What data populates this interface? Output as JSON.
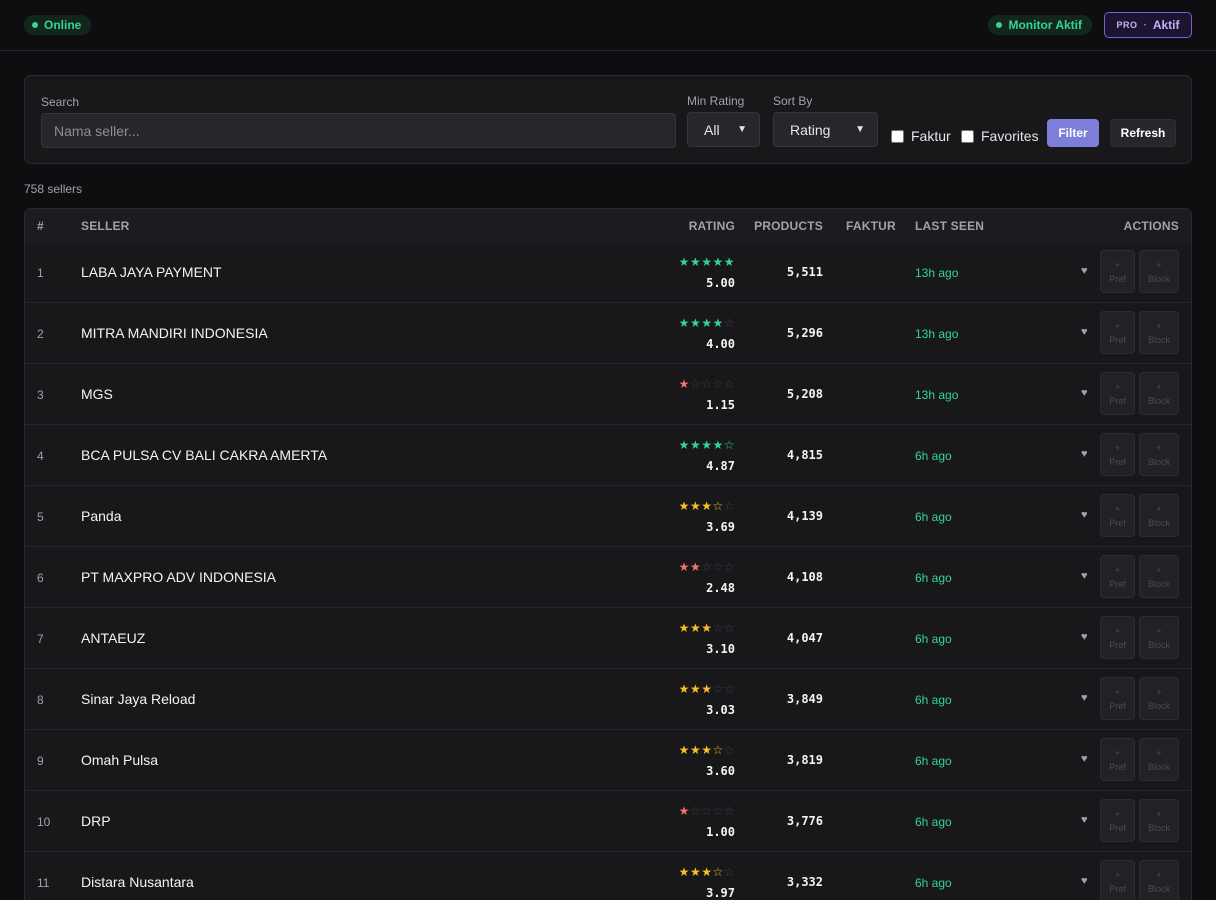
{
  "header": {
    "status_online": "Online",
    "monitor_status": "Monitor Aktif",
    "plan_label": "PRO",
    "plan_sep": "·",
    "plan_status": "Aktif"
  },
  "filters": {
    "search_label": "Search",
    "search_placeholder": "Nama seller...",
    "search_value": "",
    "min_rating_label": "Min Rating",
    "min_rating_value": "All",
    "sort_by_label": "Sort By",
    "sort_by_value": "Rating",
    "faktur_label": "Faktur",
    "faktur_checked": false,
    "favorites_label": "Favorites",
    "favorites_checked": false,
    "filter_button": "Filter",
    "refresh_button": "Refresh"
  },
  "summary": {
    "count_text": "758 sellers"
  },
  "table": {
    "columns": [
      "#",
      "SELLER",
      "RATING",
      "PRODUCTS",
      "FAKTUR",
      "LAST SEEN",
      "ACTIONS"
    ],
    "action_labels": {
      "pref": "Pref",
      "block": "Block",
      "plus": "+"
    },
    "colors": {
      "high": "#34d399",
      "mid": "#fbbf24",
      "low": "#f87171",
      "empty": "#3f3f46"
    },
    "rows": [
      {
        "num": "1",
        "seller": "LABA JAYA PAYMENT",
        "rating": 5.0,
        "rating_text": "5.00",
        "products": "5,511",
        "faktur": "",
        "last_seen": "13h ago"
      },
      {
        "num": "2",
        "seller": "MITRA MANDIRI INDONESIA",
        "rating": 4.0,
        "rating_text": "4.00",
        "products": "5,296",
        "faktur": "",
        "last_seen": "13h ago"
      },
      {
        "num": "3",
        "seller": "MGS",
        "rating": 1.15,
        "rating_text": "1.15",
        "products": "5,208",
        "faktur": "",
        "last_seen": "13h ago"
      },
      {
        "num": "4",
        "seller": "BCA PULSA CV BALI CAKRA AMERTA",
        "rating": 4.87,
        "rating_text": "4.87",
        "products": "4,815",
        "faktur": "",
        "last_seen": "6h ago"
      },
      {
        "num": "5",
        "seller": "Panda",
        "rating": 3.69,
        "rating_text": "3.69",
        "products": "4,139",
        "faktur": "",
        "last_seen": "6h ago"
      },
      {
        "num": "6",
        "seller": "PT MAXPRO ADV INDONESIA",
        "rating": 2.48,
        "rating_text": "2.48",
        "products": "4,108",
        "faktur": "",
        "last_seen": "6h ago"
      },
      {
        "num": "7",
        "seller": "ANTAEUZ",
        "rating": 3.1,
        "rating_text": "3.10",
        "products": "4,047",
        "faktur": "",
        "last_seen": "6h ago"
      },
      {
        "num": "8",
        "seller": "Sinar Jaya Reload",
        "rating": 3.03,
        "rating_text": "3.03",
        "products": "3,849",
        "faktur": "",
        "last_seen": "6h ago"
      },
      {
        "num": "9",
        "seller": "Omah Pulsa",
        "rating": 3.6,
        "rating_text": "3.60",
        "products": "3,819",
        "faktur": "",
        "last_seen": "6h ago"
      },
      {
        "num": "10",
        "seller": "DRP",
        "rating": 1.0,
        "rating_text": "1.00",
        "products": "3,776",
        "faktur": "",
        "last_seen": "6h ago"
      },
      {
        "num": "11",
        "seller": "Distara Nusantara",
        "rating": 3.97,
        "rating_text": "3.97",
        "products": "3,332",
        "faktur": "",
        "last_seen": "6h ago"
      }
    ]
  }
}
